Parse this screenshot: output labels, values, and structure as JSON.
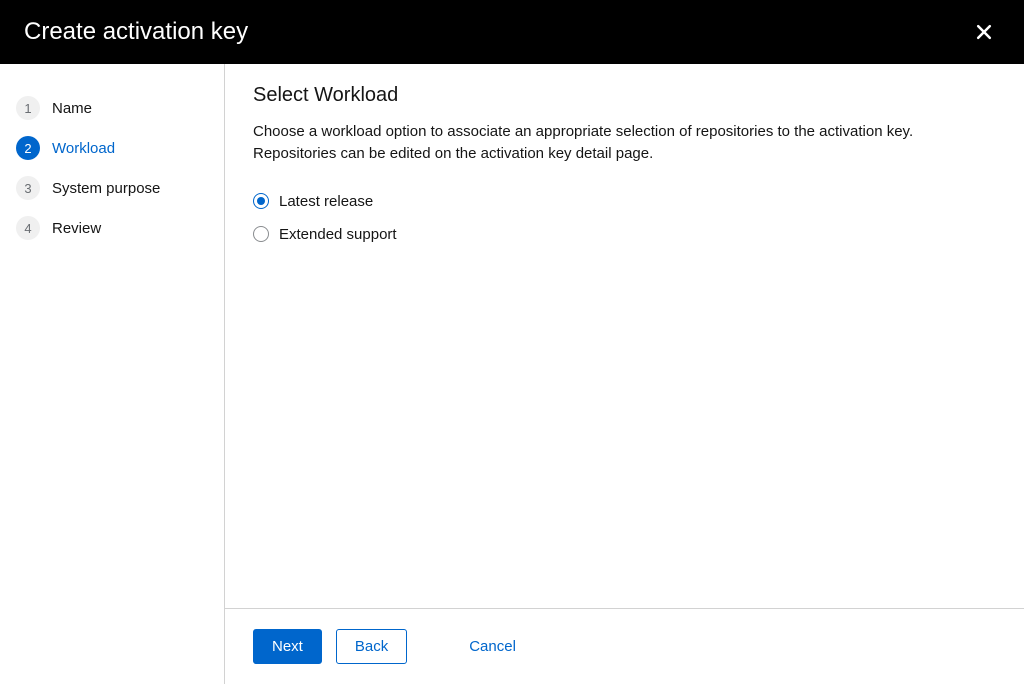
{
  "header": {
    "title": "Create activation key"
  },
  "sidebar": {
    "steps": [
      {
        "num": "1",
        "label": "Name"
      },
      {
        "num": "2",
        "label": "Workload"
      },
      {
        "num": "3",
        "label": "System purpose"
      },
      {
        "num": "4",
        "label": "Review"
      }
    ],
    "active_index": 1
  },
  "main": {
    "title": "Select Workload",
    "description": "Choose a workload option to associate an appropriate selection of repositories to the activation key. Repositories can be edited on the activation key detail page.",
    "radio": {
      "options": [
        {
          "label": "Latest release"
        },
        {
          "label": "Extended support"
        }
      ],
      "selected_index": 0
    }
  },
  "footer": {
    "next": "Next",
    "back": "Back",
    "cancel": "Cancel"
  }
}
